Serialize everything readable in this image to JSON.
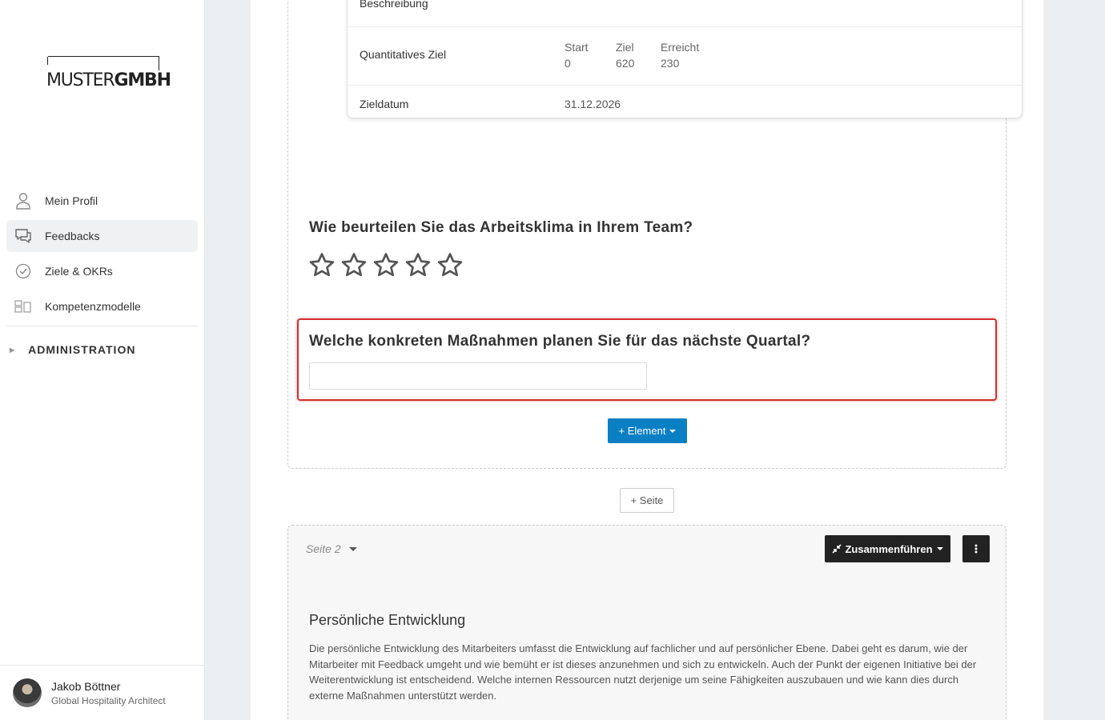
{
  "brand": {
    "logo_light": "MUSTER",
    "logo_bold": "GMBH"
  },
  "sidebar": {
    "items": [
      {
        "label": "Mein Profil",
        "icon": "user-icon"
      },
      {
        "label": "Feedbacks",
        "icon": "chat-icon"
      },
      {
        "label": "Ziele & OKRs",
        "icon": "check-circle-icon"
      },
      {
        "label": "Kompetenzmodelle",
        "icon": "grid-icon"
      }
    ],
    "active_item": "Feedbacks",
    "admin_label": "ADMINISTRATION"
  },
  "user": {
    "name": "Jakob Böttner",
    "role": "Global Hospitality Architect"
  },
  "goal_card": {
    "description_label": "Beschreibung",
    "quant_label": "Quantitatives Ziel",
    "start_label": "Start",
    "start_value": "0",
    "target_label": "Ziel",
    "target_value": "620",
    "achieved_label": "Erreicht",
    "achieved_value": "230",
    "date_label": "Zieldatum",
    "date_value": "31.12.2026"
  },
  "questions": {
    "q1": "Wie beurteilen Sie das Arbeitsklima in Ihrem Team?",
    "q1_rating": 0,
    "q1_max": 5,
    "q2": "Welche konkreten Maßnahmen planen Sie für das nächste Quartal?",
    "q2_value": ""
  },
  "buttons": {
    "add_element": "+ Element",
    "add_page": "+ Seite",
    "merge": "Zusammenführen"
  },
  "page2": {
    "label": "Seite 2",
    "section_title": "Persönliche Entwicklung",
    "section_text": "Die persönliche Entwicklung des Mitarbeiters umfasst die Entwicklung auf fachlicher und auf persönlicher Ebene. Dabei geht es darum, wie der Mitarbeiter mit Feedback umgeht und wie bemüht er ist dieses anzunehmen und sich zu entwickeln. Auch der Punkt der eigenen Initiative bei der Weiterentwicklung ist entscheidend. Welche internen Ressourcen nutzt derjenige um seine Fähigkeiten auszubauen und wie kann dies durch externe Maßnahmen unterstützt werden."
  },
  "colors": {
    "primary": "#0a7fc4",
    "highlight": "#d32f2f",
    "dark_button": "#222222"
  }
}
